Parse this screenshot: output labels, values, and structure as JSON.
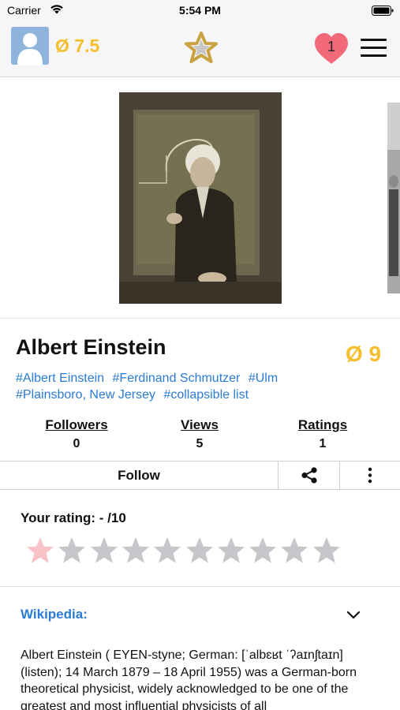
{
  "status_bar": {
    "carrier": "Carrier",
    "time": "5:54 PM",
    "wifi_icon": "wifi-icon",
    "battery_icon": "battery-icon"
  },
  "header": {
    "avatar_icon": "user-avatar-icon",
    "average_score": "Ø 7.5",
    "logo_icon": "star-logo-icon",
    "heart_count": "1",
    "menu_icon": "hamburger-menu-icon"
  },
  "profile": {
    "name": "Albert Einstein",
    "score": "Ø 9",
    "tags": [
      "#Albert Einstein",
      "#Ferdinand Schmutzer",
      "#Ulm",
      "#Plainsboro, New Jersey",
      "#collapsible list"
    ]
  },
  "stats": [
    {
      "label": "Followers",
      "value": "0"
    },
    {
      "label": "Views",
      "value": "5"
    },
    {
      "label": "Ratings",
      "value": "1"
    }
  ],
  "actions": {
    "follow_label": "Follow",
    "share_icon": "share-icon",
    "more_icon": "more-vertical-icon"
  },
  "rating": {
    "label": "Your rating: - /10",
    "max_stars": 10,
    "colors": {
      "first_star": "#f8c2c6",
      "empty_star": "#c4c6c9"
    }
  },
  "wikipedia": {
    "title": "Wikipedia:",
    "text": "Albert Einstein ( EYEN-styne; German: [ˈalbɛʁt ˈʔaɪnʃtaɪn] (listen); 14 March 1879 – 18 April 1955) was a German-born theoretical physicist, widely acknowledged to be one of the greatest and most influential physicists of all"
  },
  "colors": {
    "accent_blue": "#2a7bd6",
    "score_gold": "#f4bf2a"
  }
}
